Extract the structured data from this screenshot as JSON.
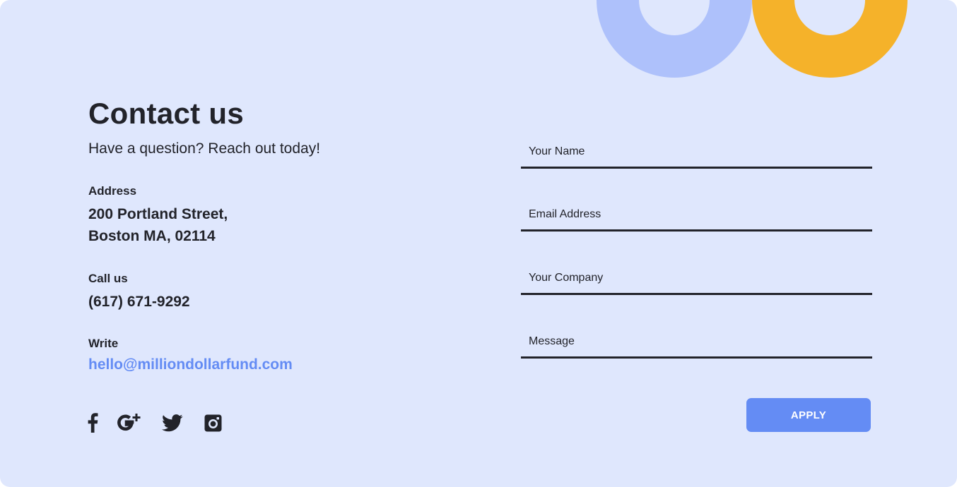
{
  "colors": {
    "background": "#dfe7fd",
    "text": "#22232a",
    "accent": "#648cf4",
    "decor_blue": "#aec1fb",
    "decor_yellow": "#f5b22a"
  },
  "header": {
    "title": "Contact us",
    "subtitle": "Have a question? Reach out today!"
  },
  "contact": {
    "address_label": "Address",
    "address_line1": "200 Portland Street,",
    "address_line2": "Boston MA, 02114",
    "phone_label": "Call us",
    "phone": "(617) 671-9292",
    "write_label": "Write",
    "email": "hello@milliondollarfund.com"
  },
  "social": [
    {
      "icon": "facebook-icon"
    },
    {
      "icon": "google-plus-icon"
    },
    {
      "icon": "twitter-icon"
    },
    {
      "icon": "instagram-icon"
    }
  ],
  "form": {
    "name_placeholder": "Your Name",
    "email_placeholder": "Email Address",
    "company_placeholder": "Your Company",
    "message_placeholder": "Message",
    "submit_label": "APPLY"
  }
}
